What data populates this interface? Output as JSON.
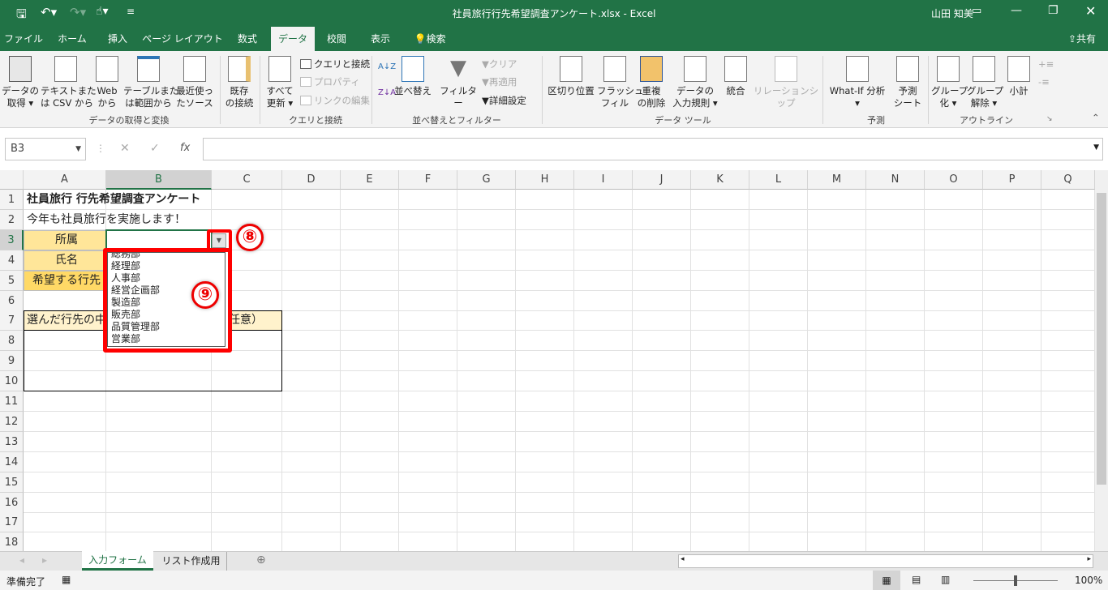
{
  "title": "社員旅行行先希望調査アンケート.xlsx  -  Excel",
  "user": "山田 知美",
  "share": "共有",
  "qat": {
    "save": "save-icon",
    "undo": "undo-icon",
    "redo": "redo-icon",
    "touch": "touch-mode-icon"
  },
  "tabs": [
    "ファイル",
    "ホーム",
    "挿入",
    "ページ レイアウト",
    "数式",
    "データ",
    "校閲",
    "表示",
    "検索"
  ],
  "active_tab": "データ",
  "ribbon": {
    "get_data": "データの\n取得 ▾",
    "text_csv": "テキストまた\nは CSV から",
    "web": "Web\nから",
    "table_range": "テーブルまた\nは範囲から",
    "recent": "最近使っ\nたソース",
    "existing": "既存\nの接続",
    "group_get": "データの取得と変換",
    "refresh_all": "すべて\n更新 ▾",
    "queries": "クエリと接続",
    "properties": "プロパティ",
    "edit_links": "リンクの編集",
    "group_queries": "クエリと接続",
    "sort": "並べ替え",
    "filter": "フィルター",
    "clear": "クリア",
    "reapply": "再適用",
    "advanced": "詳細設定",
    "group_sort": "並べ替えとフィルター",
    "text_to_columns": "区切り位置",
    "flash_fill": "フラッシュ\nフィル",
    "remove_dup": "重複\nの削除",
    "validation": "データの\n入力規則 ▾",
    "consolidate": "統合",
    "relationships": "リレーションシップ",
    "group_tools": "データ ツール",
    "whatif": "What-If 分析\n▾",
    "forecast": "予測\nシート",
    "group_forecast": "予測",
    "group_btn": "グループ\n化 ▾",
    "ungroup": "グループ\n解除 ▾",
    "subtotal": "小計",
    "group_outline": "アウトライン"
  },
  "namebox": "B3",
  "formula": "",
  "columns": [
    "A",
    "B",
    "C",
    "D",
    "E",
    "F",
    "G",
    "H",
    "I",
    "J",
    "K",
    "L",
    "M",
    "N",
    "O",
    "P",
    "Q"
  ],
  "rows": [
    "1",
    "2",
    "3",
    "4",
    "5",
    "6",
    "7",
    "8",
    "9",
    "10",
    "11",
    "12",
    "13",
    "14",
    "15",
    "16",
    "17",
    "18"
  ],
  "cells": {
    "A1": "社員旅行 行先希望調査アンケート",
    "A2": "今年も社員旅行を実施します！",
    "A3": "所属",
    "A4": "氏名",
    "A5": "希望する行先",
    "A7": "選んだ行先の中",
    "C7": "任意）"
  },
  "colors": {
    "excel_green": "#217346",
    "label_fill": "#ffe699",
    "label_fill_dark": "#ffd966",
    "note_fill": "#fff2cc",
    "highlight": "#ff0000"
  },
  "dropdown": {
    "items": [
      "総務部",
      "経理部",
      "人事部",
      "経営企画部",
      "製造部",
      "販売部",
      "品質管理部",
      "営業部"
    ]
  },
  "annotations": [
    "⑧",
    "⑨"
  ],
  "sheets": [
    "入力フォーム",
    "リスト作成用"
  ],
  "active_sheet": "入力フォーム",
  "status": "準備完了",
  "zoom": "100%"
}
